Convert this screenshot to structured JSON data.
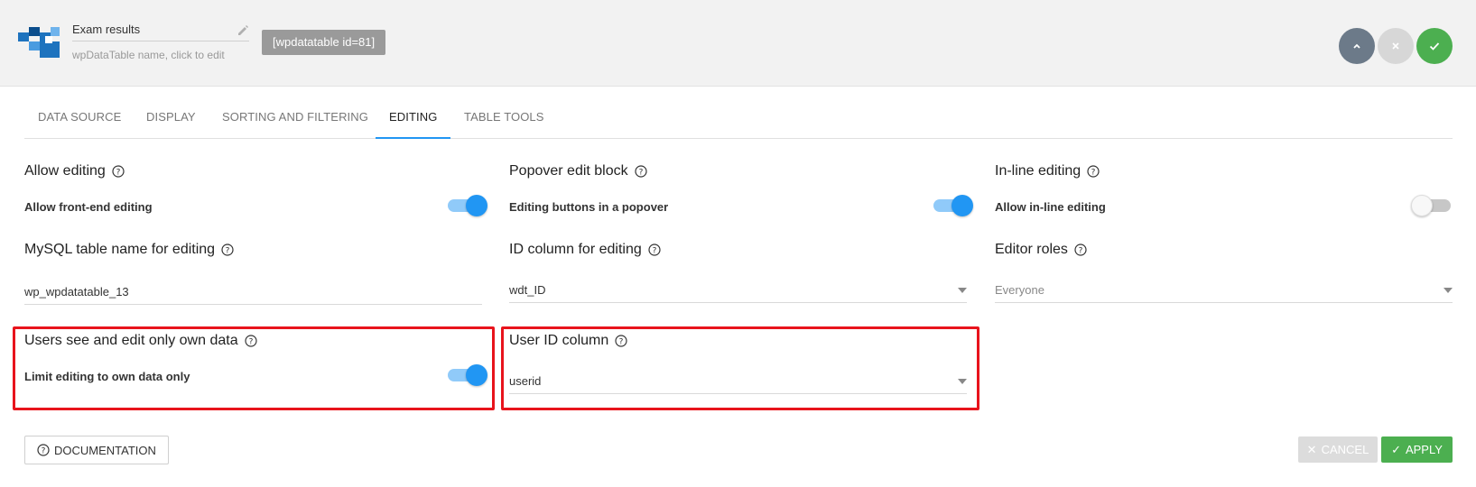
{
  "header": {
    "table_name": "Exam results",
    "table_name_hint": "wpDataTable name, click to edit",
    "shortcode": "[wpdatatable id=81]",
    "icons": {
      "logo": "wpdatatables-logo",
      "edit": "pencil-icon",
      "collapse": "chevron-up-icon",
      "close": "close-icon",
      "save": "check-icon"
    }
  },
  "tabs": [
    {
      "label": "Data source",
      "active": false
    },
    {
      "label": "Display",
      "active": false
    },
    {
      "label": "Sorting and filtering",
      "active": false
    },
    {
      "label": "Editing",
      "active": true
    },
    {
      "label": "Table tools",
      "active": false
    }
  ],
  "editing": {
    "allow_editing": {
      "title": "Allow editing",
      "option": "Allow front-end editing",
      "enabled": true
    },
    "popover": {
      "title": "Popover edit block",
      "option": "Editing buttons in a popover",
      "enabled": true
    },
    "inline": {
      "title": "In-line editing",
      "option": "Allow in-line editing",
      "enabled": false
    },
    "mysql_table": {
      "title": "MySQL table name for editing",
      "value": "wp_wpdatatable_13"
    },
    "id_column": {
      "title": "ID column for editing",
      "value": "wdt_ID"
    },
    "editor_roles": {
      "title": "Editor roles",
      "value": "Everyone"
    },
    "own_data": {
      "title": "Users see and edit only own data",
      "option": "Limit editing to own data only",
      "enabled": true
    },
    "user_id_column": {
      "title": "User ID column",
      "value": "userid"
    }
  },
  "footer": {
    "documentation": "DOCUMENTATION",
    "cancel": "CANCEL",
    "apply": "APPLY"
  },
  "colors": {
    "accent": "#2196f3",
    "success": "#4caf50",
    "highlight": "#e8141c",
    "header_bg": "#f2f2f2"
  }
}
